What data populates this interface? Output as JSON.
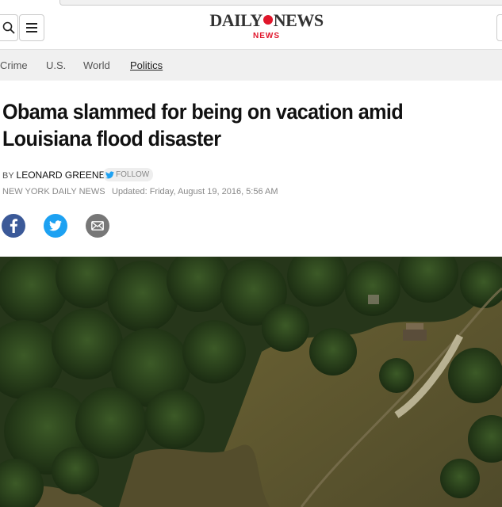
{
  "header": {
    "logo_left": "DAILY",
    "logo_right": "NEWS",
    "logo_sub": "NEWS"
  },
  "nav": {
    "items": [
      {
        "label": "Crime"
      },
      {
        "label": "U.S."
      },
      {
        "label": "World"
      },
      {
        "label": "Politics",
        "active": true
      }
    ]
  },
  "article": {
    "headline": "Obama slammed for being on vacation amid Louisiana flood disaster",
    "by_prefix": "BY",
    "author": "LEONARD GREENE",
    "follow_label": "FOLLOW",
    "source": "NEW YORK DAILY NEWS",
    "updated": "Updated: Friday, August 19, 2016, 5:56 AM"
  },
  "share": {
    "icons": [
      "facebook-icon",
      "twitter-icon",
      "email-icon"
    ],
    "colors": {
      "facebook": "#3b5998",
      "twitter": "#1da1f2",
      "email": "#777777"
    }
  },
  "colors": {
    "brand_red": "#e0162b"
  }
}
